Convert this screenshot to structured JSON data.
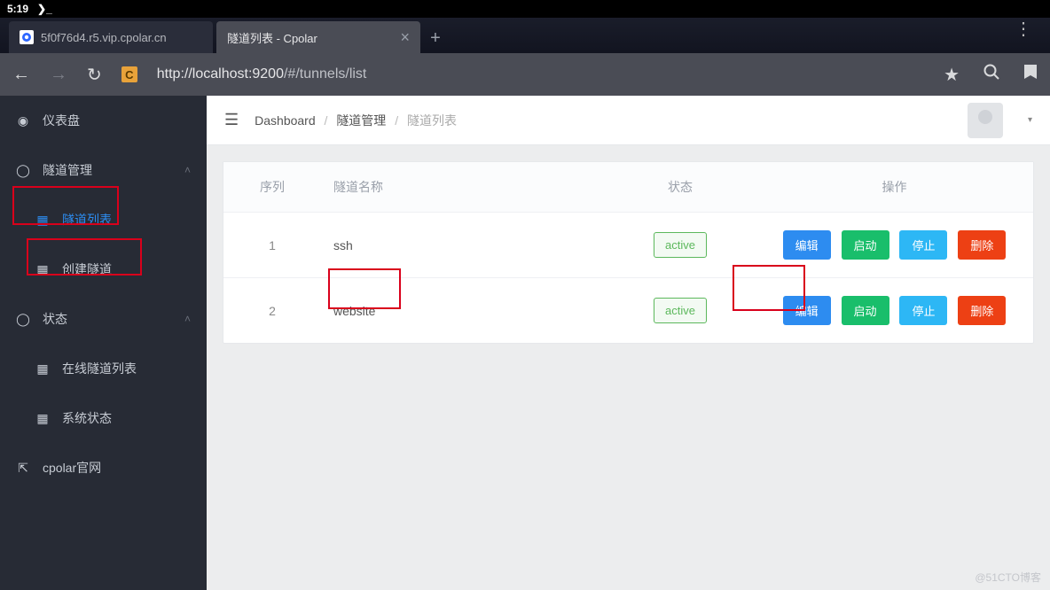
{
  "statusbar": {
    "time": "5:19"
  },
  "tabs": {
    "inactive": {
      "title": "5f0f76d4.r5.vip.cpolar.cn"
    },
    "active": {
      "title": "隧道列表 - Cpolar"
    }
  },
  "url": {
    "host": "http://localhost:9200",
    "path": "/#/tunnels/list"
  },
  "sidebar": {
    "dashboard": "仪表盘",
    "tunnel_mgmt": "隧道管理",
    "tunnel_list": "隧道列表",
    "tunnel_create": "创建隧道",
    "status": "状态",
    "online_tunnels": "在线隧道列表",
    "system_status": "系统状态",
    "official": "cpolar官网"
  },
  "breadcrumb": {
    "a": "Dashboard",
    "b": "隧道管理",
    "c": "隧道列表"
  },
  "table": {
    "headers": {
      "seq": "序列",
      "name": "隧道名称",
      "status": "状态",
      "ops": "操作"
    },
    "rows": [
      {
        "seq": "1",
        "name": "ssh",
        "status": "active"
      },
      {
        "seq": "2",
        "name": "website",
        "status": "active"
      }
    ],
    "buttons": {
      "edit": "编辑",
      "start": "启动",
      "stop": "停止",
      "delete": "删除"
    }
  },
  "watermark": "@51CTO博客"
}
